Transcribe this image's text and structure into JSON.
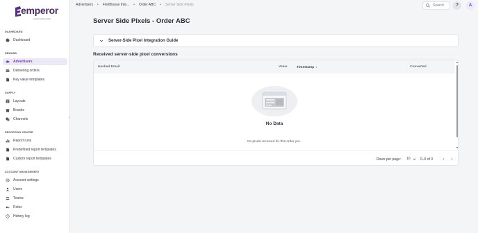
{
  "brand": {
    "name": "emperor",
    "tagline": "powered by juniper"
  },
  "sidebar": {
    "sections": [
      {
        "label": "DASHBOARD",
        "items": [
          {
            "label": "Dashboard",
            "icon": "dashboard-icon"
          }
        ]
      },
      {
        "label": "DEMAND",
        "items": [
          {
            "label": "Advertisers",
            "icon": "megaphone-icon",
            "active": true
          },
          {
            "label": "Delivering orders",
            "icon": "orders-icon"
          },
          {
            "label": "Key value templates",
            "icon": "document-icon"
          }
        ]
      },
      {
        "label": "SUPPLY",
        "items": [
          {
            "label": "Layouts",
            "icon": "layout-icon"
          },
          {
            "label": "Brands",
            "icon": "store-icon"
          },
          {
            "label": "Channels",
            "icon": "channels-icon"
          }
        ]
      },
      {
        "label": "REPORTING CENTER",
        "items": [
          {
            "label": "Report runs",
            "icon": "bar-chart-icon"
          },
          {
            "label": "Predefined report templates",
            "icon": "document-icon"
          },
          {
            "label": "Custom report templates",
            "icon": "document-icon"
          }
        ]
      },
      {
        "label": "ACCOUNT MANAGEMENT",
        "items": [
          {
            "label": "Account settings",
            "icon": "gear-icon"
          },
          {
            "label": "Users",
            "icon": "user-icon"
          },
          {
            "label": "Teams",
            "icon": "team-icon"
          },
          {
            "label": "Roles",
            "icon": "key-icon"
          },
          {
            "label": "History log",
            "icon": "history-icon"
          }
        ]
      }
    ],
    "collapse_glyph": "‹"
  },
  "header": {
    "breadcrumb": [
      "Advertisers",
      "Fieldhouse Inte...",
      "Order ABC",
      "Server Side Pixels"
    ],
    "separator": "•",
    "search_placeholder": "Search",
    "help_label": "?",
    "avatar_initial": "A"
  },
  "main": {
    "title": "Server Side Pixels - Order ABC",
    "accordion_title": "Server-Side Pixel Integration Guide",
    "table_title": "Received server-side pixel conversions",
    "columns": [
      "Hashed Email",
      "Value",
      "Timestamp",
      "Converted"
    ],
    "sort_indicator": "↓",
    "empty_title": "No Data",
    "empty_description": "No pixels received for this order yet..",
    "rows_per_page_label": "Rows per page:",
    "rows_per_page_value": "10",
    "range_label": "0–0 of 0"
  },
  "colors": {
    "accent": "#6a3fb3",
    "active_bg": "#ece9f6",
    "page_bg": "#f4f5f7"
  }
}
